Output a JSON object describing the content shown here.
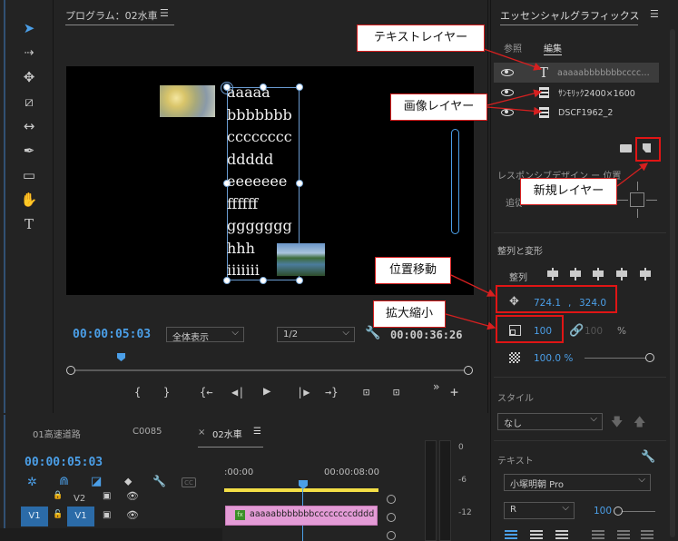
{
  "program": {
    "title": "プログラム：02水車",
    "menu_icon": "☰",
    "timecode": "00:00:05:03",
    "zoom_select": "全体表示",
    "quality_select": "1/2",
    "duration": "00:00:36:26",
    "sample_lines": [
      "aaaaa",
      "bbbbbbb",
      "cccccccc",
      "ddddd",
      "eeeeeee",
      "ffffff",
      "ggggggg",
      "hhh",
      "iiiiiii"
    ],
    "controls": [
      "{",
      "}",
      "{←",
      "◀|",
      "▶",
      "|▶",
      "→}",
      "⊡",
      "⊡",
      "»",
      "+"
    ]
  },
  "tools": [
    "selection-tool",
    "track-select-tool",
    "ripple-edit-tool",
    "razor-tool",
    "slip-tool",
    "pen-tool",
    "rectangle-tool",
    "hand-tool",
    "type-tool"
  ],
  "essential_graphics": {
    "title": "エッセンシャルグラフィックス",
    "menu_icon": "☰",
    "tabs": [
      "参照",
      "編集"
    ],
    "layers": [
      {
        "name": "aaaaabbbbbbbcccc…",
        "type": "text"
      },
      {
        "name": "ｻﾝﾓﾘｯｸ2400×1600",
        "type": "image"
      },
      {
        "name": "DSCF1962_2",
        "type": "image"
      }
    ],
    "responsive_label": "レスポンシブデザイン ー 位置",
    "pin_label": "追従",
    "align_section": "整列と変形",
    "align_label": "整列",
    "position": {
      "x": "724.1",
      "y": "324.0",
      "sep": ","
    },
    "scale": {
      "value": "100",
      "linked_value": "100",
      "unit": "%"
    },
    "opacity": "100.0 %",
    "style_section": "スタイル",
    "style_select": "なし",
    "text_section": "テキスト",
    "font_select": "小塚明朝 Pro",
    "font_style_select": "R",
    "font_size": "100"
  },
  "timeline": {
    "tabs": [
      "01高速道路",
      "C0085",
      "02水車"
    ],
    "tab_close": "×",
    "menu_icon": "☰",
    "timecode": "00:00:05:03",
    "ruler": [
      ":00:00",
      "00:00:08:00"
    ],
    "tracks": [
      {
        "label": "V2",
        "source": ""
      },
      {
        "label": "V1",
        "source": "V1"
      }
    ],
    "clip_label": "aaaaabbbbbbbccccccccdddd",
    "clip_fx": "fx"
  },
  "meter": {
    "ticks": [
      "0",
      "-6",
      "-12"
    ]
  },
  "callouts": {
    "text_layer": "テキストレイヤー",
    "image_layer": "画像レイヤー",
    "new_layer": "新規レイヤー",
    "position_move": "位置移動",
    "scale": "拡大縮小"
  },
  "colors": {
    "accent": "#4b9fe8",
    "callout_border": "#d62020",
    "clip": "#e39bd6"
  }
}
